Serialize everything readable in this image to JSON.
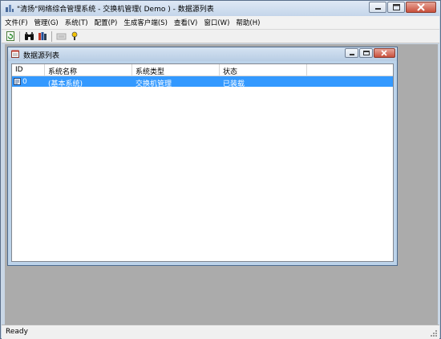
{
  "window": {
    "title": "\"清扬\"网络综合管理系统 - 交换机管理( Demo ) - 数据源列表"
  },
  "menu": [
    {
      "label": "文件(F)"
    },
    {
      "label": "管理(G)"
    },
    {
      "label": "系统(T)"
    },
    {
      "label": "配置(P)"
    },
    {
      "label": "生成客户端(S)"
    },
    {
      "label": "查看(V)"
    },
    {
      "label": "窗口(W)"
    },
    {
      "label": "帮助(H)"
    }
  ],
  "toolbar": {
    "icons": [
      "refresh-icon",
      "binoculars-icon",
      "books-icon",
      "disabled-icon",
      "help-icon"
    ]
  },
  "child_window": {
    "title": "数据源列表"
  },
  "table": {
    "columns": [
      "ID",
      "系统名称",
      "系统类型",
      "状态"
    ],
    "rows": [
      {
        "id": "0",
        "name": "(基本系统)",
        "type": "交换机管理",
        "status": "已装载",
        "selected": true
      }
    ]
  },
  "statusbar": {
    "text": "Ready"
  },
  "colors": {
    "selection": "#3399ff",
    "mdi_background": "#ababab",
    "title_gradient": "#c4d5ea"
  }
}
